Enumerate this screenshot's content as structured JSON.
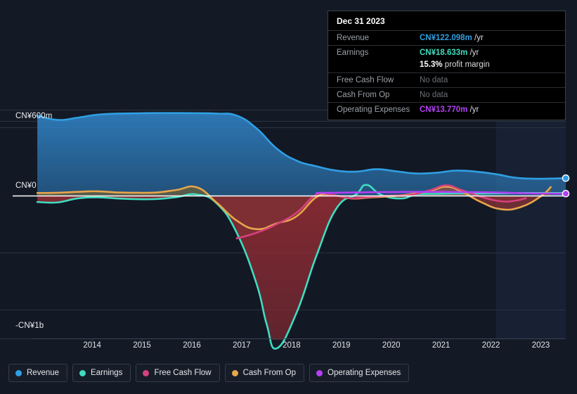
{
  "background": "#141a25",
  "tooltip": {
    "date": "Dec 31 2023",
    "rows": [
      {
        "label": "Revenue",
        "value": "CN¥122.098m",
        "unit": "/yr",
        "color": "#2f9fe3",
        "nodata": false
      },
      {
        "label": "Earnings",
        "value": "CN¥18.633m",
        "unit": "/yr",
        "color": "#3fdcc0",
        "nodata": false
      },
      {
        "label": "",
        "value": "15.3%",
        "unit": "profit margin",
        "color": "#ffffff",
        "nodata": false
      },
      {
        "label": "Free Cash Flow",
        "value": "No data",
        "unit": "",
        "color": "#6b7075",
        "nodata": true
      },
      {
        "label": "Cash From Op",
        "value": "No data",
        "unit": "",
        "color": "#6b7075",
        "nodata": true
      },
      {
        "label": "Operating Expenses",
        "value": "CN¥13.770m",
        "unit": "/yr",
        "color": "#b43ff5",
        "nodata": false
      }
    ]
  },
  "legend": [
    {
      "label": "Revenue",
      "color": "#2f9fe3"
    },
    {
      "label": "Earnings",
      "color": "#3fdcc0"
    },
    {
      "label": "Free Cash Flow",
      "color": "#d6417e"
    },
    {
      "label": "Cash From Op",
      "color": "#e8a54b"
    },
    {
      "label": "Operating Expenses",
      "color": "#b43ff5"
    }
  ],
  "chart_data": {
    "type": "area",
    "title": "",
    "xlabel": "",
    "ylabel": "",
    "currency": "CN¥",
    "grid": true,
    "legend_position": "bottom",
    "ylim": [
      -1100,
      640
    ],
    "ytick_labels": [
      "CN¥600m",
      "CN¥0",
      "-CN¥1b"
    ],
    "ytick_values": [
      600,
      0,
      -1000
    ],
    "xtick_labels": [
      "2014",
      "2015",
      "2016",
      "2017",
      "2018",
      "2019",
      "2020",
      "2021",
      "2022",
      "2023"
    ],
    "xlim": [
      2013.3,
      2024.0
    ],
    "zero_line": 0,
    "highlight_band": {
      "from": 2022.6,
      "to": 2024.0,
      "label": ""
    },
    "series": [
      {
        "name": "Revenue",
        "color": "#2f9fe3",
        "fill": "#1b4b73",
        "end_marker": true,
        "x": [
          2013.4,
          2013.8,
          2014.2,
          2014.6,
          2015.0,
          2015.4,
          2015.8,
          2016.2,
          2016.6,
          2017.0,
          2017.4,
          2017.8,
          2018.2,
          2018.6,
          2019.0,
          2019.4,
          2019.8,
          2020.2,
          2020.6,
          2021.0,
          2021.4,
          2021.8,
          2022.2,
          2022.6,
          2023.0,
          2023.4,
          2023.8,
          2024.0
        ],
        "y": [
          560,
          530,
          545,
          566,
          574,
          576,
          578,
          578,
          577,
          574,
          560,
          470,
          330,
          245,
          205,
          175,
          168,
          185,
          170,
          155,
          160,
          175,
          168,
          150,
          125,
          118,
          120,
          122
        ]
      },
      {
        "name": "Earnings",
        "color": "#3fdcc0",
        "fill": "#6d2630",
        "end_marker": false,
        "x": [
          2013.4,
          2013.8,
          2014.2,
          2014.6,
          2015.0,
          2015.4,
          2015.8,
          2016.2,
          2016.6,
          2017.0,
          2017.4,
          2017.8,
          2018.0,
          2018.2,
          2018.6,
          2019.0,
          2019.4,
          2019.8,
          2020.0,
          2020.3,
          2020.7,
          2021.0,
          2021.4,
          2021.8,
          2022.2,
          2022.6,
          2023.0,
          2023.4,
          2023.8,
          2024.0
        ],
        "y": [
          -45,
          -48,
          -20,
          -12,
          -20,
          -25,
          -24,
          -10,
          8,
          -55,
          -260,
          -620,
          -900,
          -1070,
          -820,
          -420,
          -90,
          10,
          75,
          5,
          -20,
          8,
          12,
          15,
          14,
          16,
          18,
          18,
          18,
          18
        ]
      },
      {
        "name": "Free Cash Flow",
        "color": "#d6417e",
        "fill": "#6d2630",
        "end_marker": false,
        "x": [
          2017.4,
          2017.8,
          2018.2,
          2018.6,
          2019.0,
          2019.3,
          2019.7,
          2020.1,
          2020.5,
          2020.9,
          2021.3,
          2021.6,
          2021.9,
          2022.3,
          2022.7,
          2023.0,
          2023.2
        ],
        "y": [
          -300,
          -260,
          -200,
          -120,
          8,
          5,
          -18,
          -8,
          0,
          5,
          40,
          72,
          40,
          -8,
          -40,
          -35,
          -18
        ]
      },
      {
        "name": "Cash From Op",
        "color": "#e8a54b",
        "fill": "#6d2630",
        "end_marker": false,
        "x": [
          2013.4,
          2013.8,
          2014.2,
          2014.6,
          2015.0,
          2015.4,
          2015.8,
          2016.2,
          2016.6,
          2017.0,
          2017.4,
          2017.8,
          2018.2,
          2018.6,
          2019.0,
          2019.3,
          2019.7,
          2020.1,
          2020.5,
          2020.9,
          2021.3,
          2021.6,
          2021.9,
          2022.3,
          2022.7,
          2023.1,
          2023.5,
          2023.7
        ],
        "y": [
          18,
          20,
          26,
          30,
          22,
          20,
          22,
          40,
          58,
          -50,
          -175,
          -235,
          -195,
          -145,
          -10,
          5,
          -20,
          -12,
          -5,
          10,
          35,
          62,
          30,
          -45,
          -95,
          -80,
          -5,
          60
        ]
      },
      {
        "name": "Operating Expenses",
        "color": "#b43ff5",
        "fill": "none",
        "end_marker": true,
        "x": [
          2019.0,
          2019.4,
          2019.8,
          2020.2,
          2020.6,
          2021.0,
          2021.4,
          2021.8,
          2022.2,
          2022.6,
          2023.0,
          2023.4,
          2023.8,
          2024.0
        ],
        "y": [
          18,
          20,
          22,
          24,
          25,
          26,
          26,
          25,
          24,
          22,
          18,
          15,
          14,
          13.77
        ]
      }
    ]
  }
}
